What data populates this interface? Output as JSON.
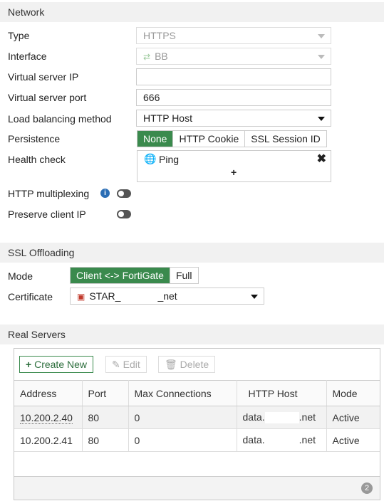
{
  "network": {
    "section_title": "Network",
    "type": {
      "label": "Type",
      "value": "HTTPS"
    },
    "interface": {
      "label": "Interface",
      "value": "BB"
    },
    "vip": {
      "label": "Virtual server IP",
      "value": ""
    },
    "vport": {
      "label": "Virtual server port",
      "value": "666"
    },
    "lb": {
      "label": "Load balancing method",
      "value": "HTTP Host"
    },
    "persistence": {
      "label": "Persistence",
      "options": [
        "None",
        "HTTP Cookie",
        "SSL Session ID"
      ],
      "selected": "None"
    },
    "health": {
      "label": "Health check",
      "item": "Ping",
      "add": "+"
    },
    "multiplex": {
      "label": "HTTP multiplexing",
      "info": "i"
    },
    "preserve": {
      "label": "Preserve client IP"
    }
  },
  "ssl": {
    "section_title": "SSL Offloading",
    "mode": {
      "label": "Mode",
      "options": [
        "Client <-> FortiGate",
        "Full"
      ],
      "selected": "Client <-> FortiGate"
    },
    "certificate": {
      "label": "Certificate",
      "value_prefix": "STAR_",
      "value_suffix": "_net"
    }
  },
  "real_servers": {
    "section_title": "Real Servers",
    "toolbar": {
      "create": "Create New",
      "create_icon": "+",
      "edit": "Edit",
      "delete": "Delete"
    },
    "columns": [
      "Address",
      "Port",
      "Max Connections",
      "HTTP Host",
      "Mode"
    ],
    "rows": [
      {
        "address": "10.200.2.40",
        "port": "80",
        "max": "0",
        "host_prefix": "data.",
        "host_suffix": ".net",
        "mode": "Active"
      },
      {
        "address": "10.200.2.41",
        "port": "80",
        "max": "0",
        "host_prefix": "data.",
        "host_suffix": ".net",
        "mode": "Active"
      }
    ],
    "count": "2"
  },
  "colors": {
    "accent": "#3a8a4d",
    "info": "#2a6db5"
  }
}
